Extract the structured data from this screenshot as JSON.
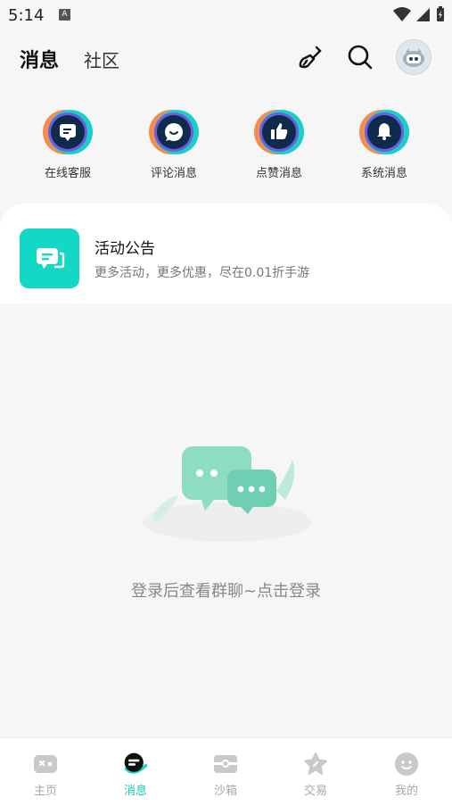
{
  "status_bar": {
    "time": "5:14",
    "badge": "A"
  },
  "header": {
    "tab_messages": "消息",
    "tab_community": "社区"
  },
  "quick_actions": [
    {
      "label": "在线客服",
      "icon": "customer-service-icon"
    },
    {
      "label": "评论消息",
      "icon": "comment-icon"
    },
    {
      "label": "点赞消息",
      "icon": "thumbs-up-icon"
    },
    {
      "label": "系统消息",
      "icon": "bell-icon"
    }
  ],
  "notice": {
    "title": "活动公告",
    "subtitle": "更多活动，更多优惠，尽在0.01折手游"
  },
  "empty_state": {
    "text": "登录后查看群聊~点击登录"
  },
  "bottom_nav": [
    {
      "label": "主页",
      "active": false
    },
    {
      "label": "消息",
      "active": true
    },
    {
      "label": "沙箱",
      "active": false
    },
    {
      "label": "交易",
      "active": false
    },
    {
      "label": "我的",
      "active": false
    }
  ],
  "colors": {
    "accent": "#14d8c6",
    "active_text": "#12c8b6",
    "inactive": "#a7a7a7",
    "dark_icon": "#0f2a4a"
  }
}
